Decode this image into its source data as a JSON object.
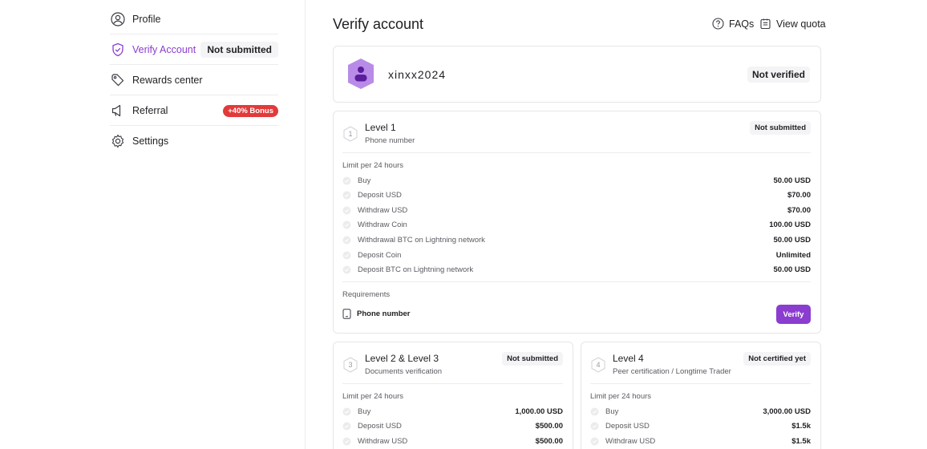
{
  "sidebar": {
    "items": [
      {
        "label": "Profile",
        "icon": "user-circle-icon"
      },
      {
        "label": "Verify Account",
        "icon": "shield-check-icon",
        "badge": "Not submitted"
      },
      {
        "label": "Rewards center",
        "icon": "tag-icon"
      },
      {
        "label": "Referral",
        "icon": "megaphone-icon",
        "badge": "+40% Bonus"
      },
      {
        "label": "Settings",
        "icon": "gear-icon"
      }
    ]
  },
  "header": {
    "title": "Verify account",
    "faqs_label": "FAQs",
    "quota_label": "View quota"
  },
  "profile": {
    "username": "xinxx2024",
    "status": "Not verified"
  },
  "colors": {
    "accent": "#8b3dcf",
    "badge_red": "#e23a3a"
  },
  "level1": {
    "number": "1",
    "title": "Level 1",
    "subtitle": "Phone number",
    "status": "Not submitted",
    "limit_title": "Limit per 24 hours",
    "limits": [
      {
        "name": "Buy",
        "value": "50.00 USD"
      },
      {
        "name": "Deposit USD",
        "value": "$70.00"
      },
      {
        "name": "Withdraw USD",
        "value": "$70.00"
      },
      {
        "name": "Withdraw Coin",
        "value": "100.00 USD"
      },
      {
        "name": "Withdrawal BTC on Lightning network",
        "value": "50.00 USD"
      },
      {
        "name": "Deposit Coin",
        "value": "Unlimited"
      },
      {
        "name": "Deposit BTC on Lightning network",
        "value": "50.00 USD"
      }
    ],
    "requirements_title": "Requirements",
    "requirement": "Phone number",
    "verify_label": "Verify"
  },
  "level23": {
    "number": "3",
    "title": "Level 2 & Level 3",
    "subtitle": "Documents verification",
    "status": "Not submitted",
    "limit_title": "Limit per 24 hours",
    "limits": [
      {
        "name": "Buy",
        "value": "1,000.00 USD"
      },
      {
        "name": "Deposit USD",
        "value": "$500.00"
      },
      {
        "name": "Withdraw USD",
        "value": "$500.00"
      }
    ]
  },
  "level4": {
    "number": "4",
    "title": "Level 4",
    "subtitle": "Peer certification / Longtime Trader",
    "status": "Not certified yet",
    "limit_title": "Limit per 24 hours",
    "limits": [
      {
        "name": "Buy",
        "value": "3,000.00 USD"
      },
      {
        "name": "Deposit USD",
        "value": "$1.5k"
      },
      {
        "name": "Withdraw USD",
        "value": "$1.5k"
      }
    ]
  }
}
